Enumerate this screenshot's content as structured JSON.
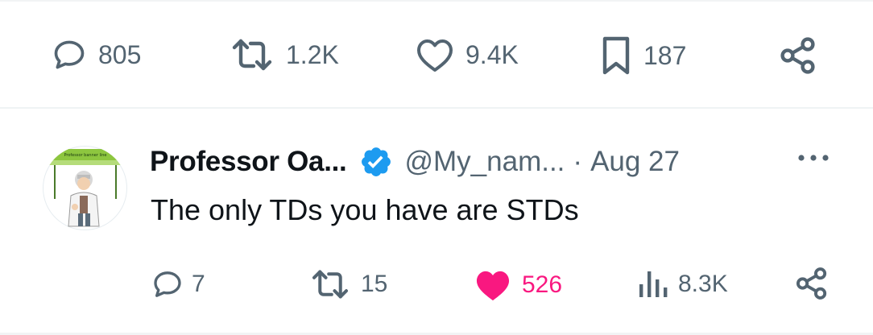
{
  "main_tweet_actions": {
    "replies": "805",
    "retweets": "1.2K",
    "likes": "9.4K",
    "bookmarks": "187"
  },
  "reply": {
    "display_name": "Professor Oa...",
    "handle": "@My_nam...",
    "separator": "·",
    "date": "Aug 27",
    "text": "The only TDs you have are STDs",
    "avatar_banner_text": "Professor banner line",
    "actions": {
      "replies": "7",
      "retweets": "15",
      "likes": "526",
      "views": "8.3K"
    }
  },
  "colors": {
    "icon_gray": "#536471",
    "like_pink": "#f91880",
    "verified_blue": "#1d9bf0",
    "text_dark": "#0f1419"
  },
  "icons": [
    "reply-icon",
    "retweet-icon",
    "like-icon",
    "bookmark-icon",
    "share-icon",
    "verified-icon",
    "more-icon",
    "views-icon"
  ]
}
